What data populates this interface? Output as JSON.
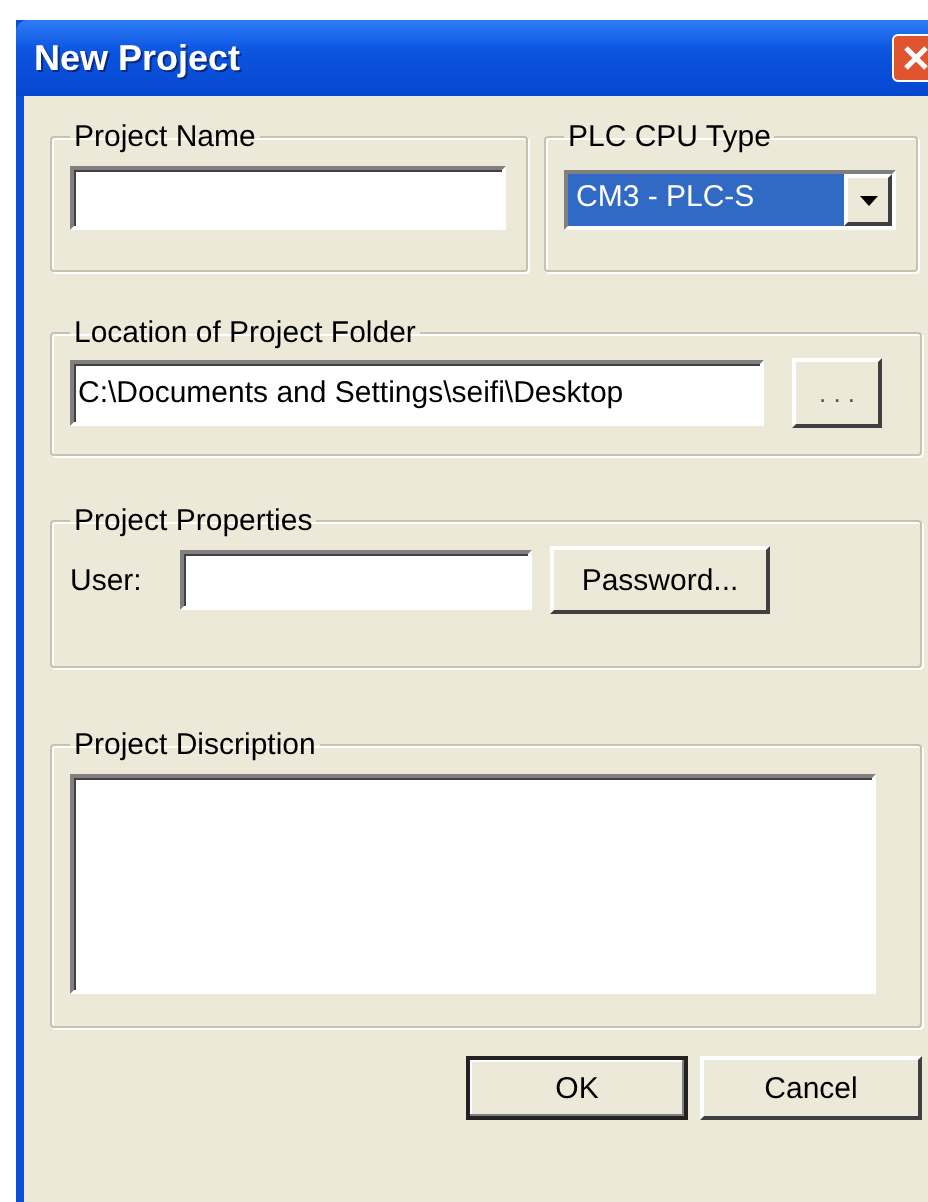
{
  "window": {
    "title": "New Project"
  },
  "project_name": {
    "label": "Project Name"
  },
  "plc_cpu_type": {
    "label": "PLC CPU Type",
    "value": "CM3 - PLC-S",
    "highlighted": true
  },
  "location": {
    "label": "Location of Project Folder",
    "value": "C:\\Documents and Settings\\seifi\\Desktop",
    "browse_button": ". . ."
  },
  "properties": {
    "label": "Project Properties",
    "user_label": "User:",
    "password_button": "Password..."
  },
  "description": {
    "label": "Project Discription"
  },
  "buttons": [
    {
      "label": "OK",
      "default": true
    },
    {
      "label": "Cancel",
      "default": false
    }
  ]
}
